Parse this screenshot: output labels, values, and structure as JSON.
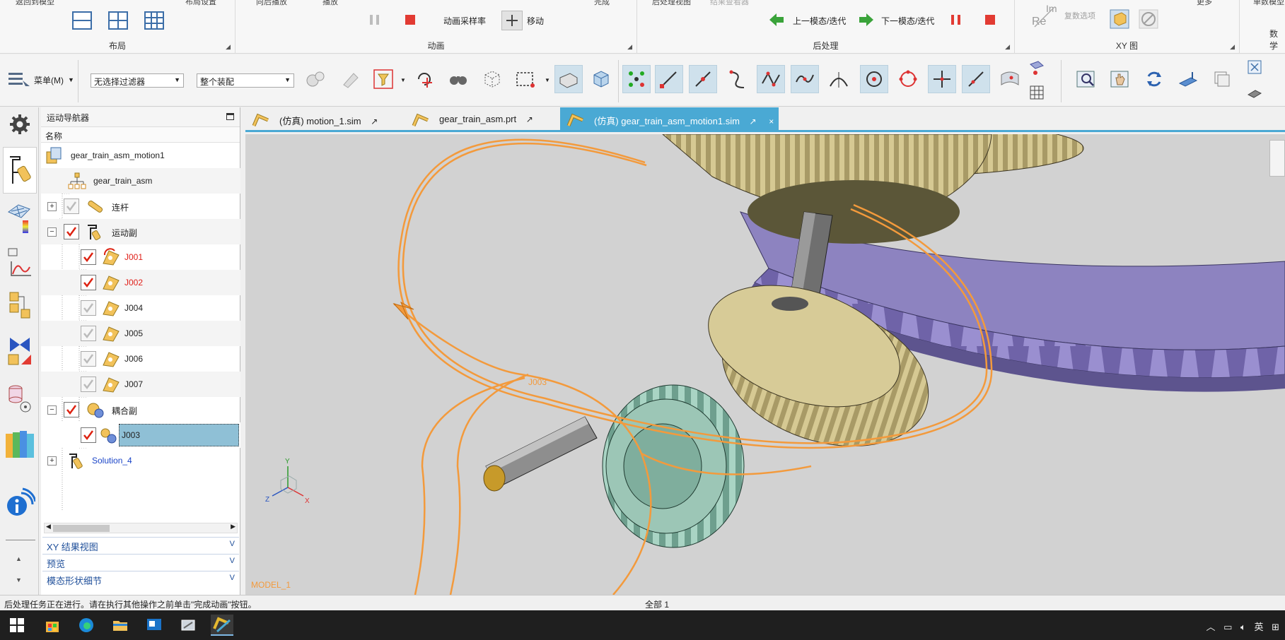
{
  "ribbon": {
    "cut_labels": [
      "返回到模型",
      "布局设置",
      "向后播放",
      "播放",
      "完成",
      "后处理视图",
      "结果查看器",
      "复数选项",
      "更多",
      "单数模型"
    ],
    "groups": [
      {
        "label": "布局"
      },
      {
        "label": "动画"
      },
      {
        "label": "后处理"
      },
      {
        "label": "XY 图"
      },
      {
        "label": "数学"
      }
    ],
    "animation": {
      "sampling_label": "动画采样率",
      "move_label": "移动"
    },
    "postprocess": {
      "prev_label": "上一模态/迭代",
      "next_label": "下一模态/迭代"
    },
    "xy": {
      "re": "Re",
      "im": "Im"
    }
  },
  "toolbar": {
    "menu_label": "菜单(M)",
    "filter_value": "无选择过滤器",
    "assembly_value": "整个装配"
  },
  "navigator": {
    "title": "运动导航器",
    "column_header": "名称",
    "rows": [
      {
        "label": "gear_train_asm_motion1"
      },
      {
        "label": "gear_train_asm"
      },
      {
        "label": "连杆"
      },
      {
        "label": "运动副"
      },
      {
        "label": "J001"
      },
      {
        "label": "J002"
      },
      {
        "label": "J004"
      },
      {
        "label": "J005"
      },
      {
        "label": "J006"
      },
      {
        "label": "J007"
      },
      {
        "label": "耦合副"
      },
      {
        "label": "J003"
      },
      {
        "label": "Solution_4"
      }
    ],
    "panels": [
      {
        "label": "XY 结果视图"
      },
      {
        "label": "预览"
      },
      {
        "label": "模态形状细节"
      }
    ]
  },
  "tabs": [
    {
      "label": "(仿真) motion_1.sim",
      "active": false
    },
    {
      "label": "gear_train_asm.prt",
      "active": false
    },
    {
      "label": "(仿真) gear_train_asm_motion1.sim",
      "active": true
    }
  ],
  "viewport": {
    "joint_label": "J003",
    "model_label": "MODEL_1",
    "triad": {
      "x": "X",
      "y": "Y",
      "z": "Z"
    }
  },
  "status": {
    "message": "后处理任务正在进行。请在执行其他操作之前单击\"完成动画\"按钮。",
    "selection": "全部 1"
  },
  "taskbar": {
    "tray_text": "英"
  },
  "colors": {
    "accent_tab": "#4aa9d4",
    "path_orange": "#f39a3c",
    "gear_tan": "#c9bb8a",
    "gear_purple": "#8d83c0",
    "gear_green": "#8fbfae"
  }
}
